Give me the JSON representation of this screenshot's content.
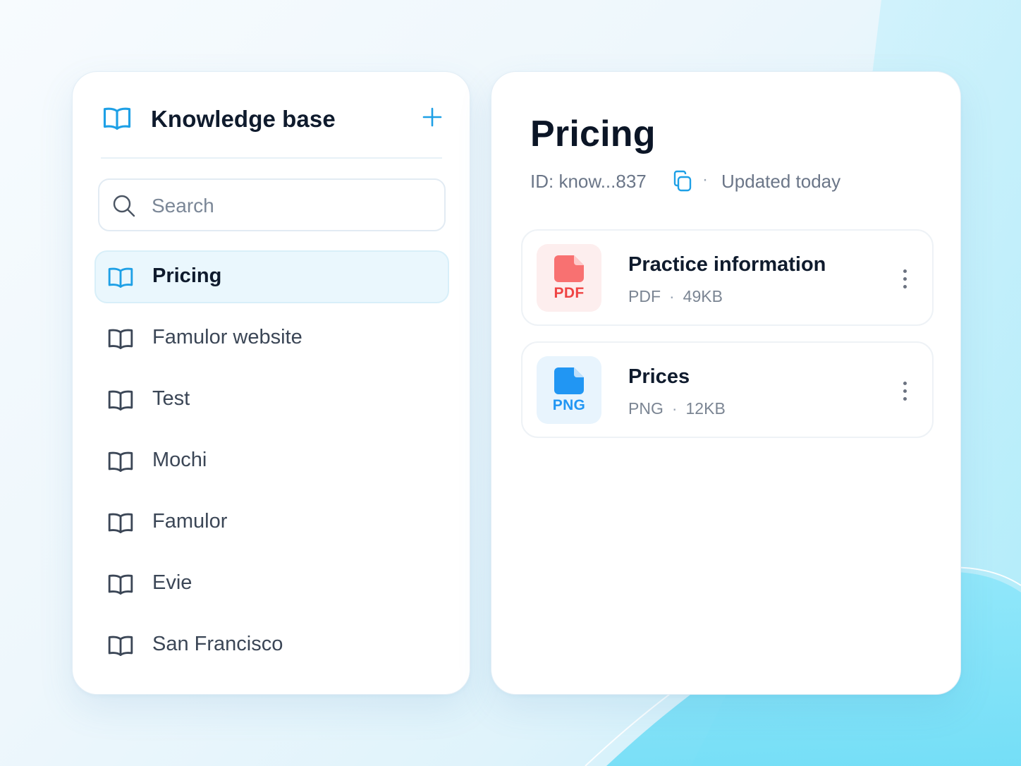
{
  "colors": {
    "accent": "#1ea0e6",
    "active_bg": "#eaf7fd",
    "pdf_red": "#ef4444",
    "png_blue": "#2196f3",
    "heading": "#0f1b2d"
  },
  "sidebar": {
    "title": "Knowledge base",
    "title_icon": "book-open-icon",
    "add_icon": "plus-icon",
    "search": {
      "placeholder": "Search",
      "value": "",
      "icon": "search-icon"
    },
    "items": [
      {
        "label": "Pricing",
        "icon": "book-open-icon",
        "active": true
      },
      {
        "label": "Famulor website",
        "icon": "book-open-icon",
        "active": false
      },
      {
        "label": "Test",
        "icon": "book-open-icon",
        "active": false
      },
      {
        "label": "Mochi",
        "icon": "book-open-icon",
        "active": false
      },
      {
        "label": "Famulor",
        "icon": "book-open-icon",
        "active": false
      },
      {
        "label": "Evie",
        "icon": "book-open-icon",
        "active": false
      },
      {
        "label": "San Francisco",
        "icon": "book-open-icon",
        "active": false
      }
    ]
  },
  "main": {
    "title": "Pricing",
    "meta": {
      "id_text": "ID: know...837",
      "copy_icon": "copy-icon",
      "separator": "·",
      "updated": "Updated today"
    },
    "files": [
      {
        "name": "Practice information",
        "badge": "PDF",
        "type": "PDF",
        "separator": "·",
        "size": "49KB",
        "icon": "file-icon",
        "menu_icon": "more-vertical-icon"
      },
      {
        "name": "Prices",
        "badge": "PNG",
        "type": "PNG",
        "separator": "·",
        "size": "12KB",
        "icon": "file-icon",
        "menu_icon": "more-vertical-icon"
      }
    ]
  }
}
